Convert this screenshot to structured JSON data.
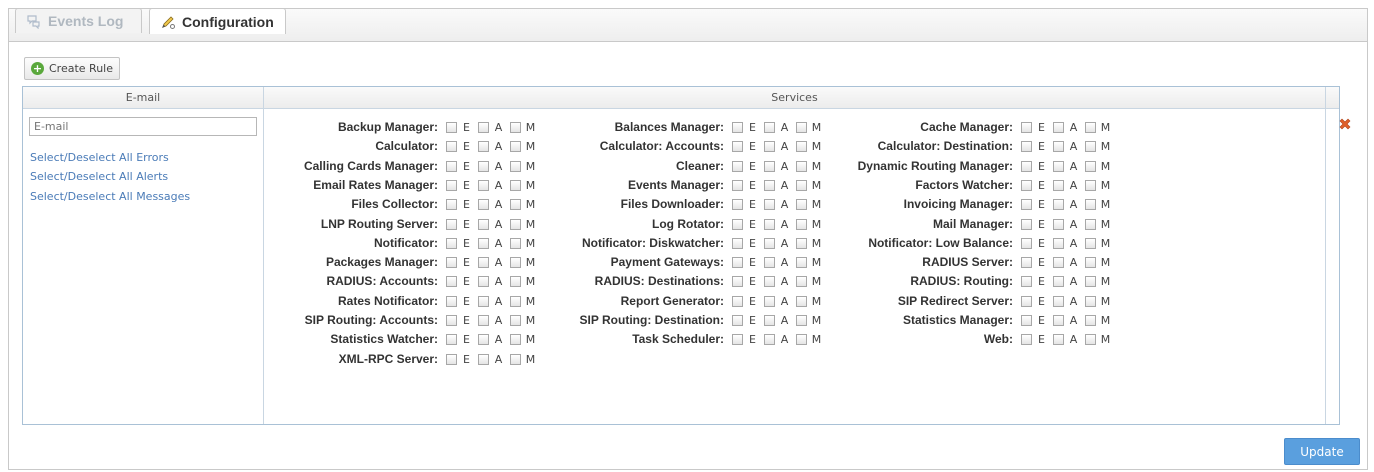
{
  "tabs": [
    {
      "label": "Events Log",
      "icon": "chat-bubbles-icon",
      "active": false
    },
    {
      "label": "Configuration",
      "icon": "pencil-config-icon",
      "active": true
    }
  ],
  "toolbar": {
    "create_rule_label": "Create Rule"
  },
  "table": {
    "headers": {
      "email": "E-mail",
      "services": "Services"
    },
    "email_placeholder": "E-mail",
    "select_links": [
      "Select/Deselect All Errors",
      "Select/Deselect All Alerts",
      "Select/Deselect All Messages"
    ],
    "flags": [
      "E",
      "A",
      "M"
    ],
    "services": [
      [
        "Backup Manager:",
        "Balances Manager:",
        "Cache Manager:"
      ],
      [
        "Calculator:",
        "Calculator: Accounts:",
        "Calculator: Destination:"
      ],
      [
        "Calling Cards Manager:",
        "Cleaner:",
        "Dynamic Routing Manager:"
      ],
      [
        "Email Rates Manager:",
        "Events Manager:",
        "Factors Watcher:"
      ],
      [
        "Files Collector:",
        "Files Downloader:",
        "Invoicing Manager:"
      ],
      [
        "LNP Routing Server:",
        "Log Rotator:",
        "Mail Manager:"
      ],
      [
        "Notificator:",
        "Notificator: Diskwatcher:",
        "Notificator: Low Balance:"
      ],
      [
        "Packages Manager:",
        "Payment Gateways:",
        "RADIUS Server:"
      ],
      [
        "RADIUS: Accounts:",
        "RADIUS: Destinations:",
        "RADIUS: Routing:"
      ],
      [
        "Rates Notificator:",
        "Report Generator:",
        "SIP Redirect Server:"
      ],
      [
        "SIP Routing: Accounts:",
        "SIP Routing: Destination:",
        "Statistics Manager:"
      ],
      [
        "Statistics Watcher:",
        "Task Scheduler:",
        "Web:"
      ],
      [
        "XML-RPC Server:"
      ]
    ]
  },
  "footer": {
    "update_label": "Update"
  },
  "colors": {
    "accent": "#5a9fde",
    "link": "#4a7bb7",
    "delete": "#e0602a",
    "add": "#5aa83c"
  }
}
